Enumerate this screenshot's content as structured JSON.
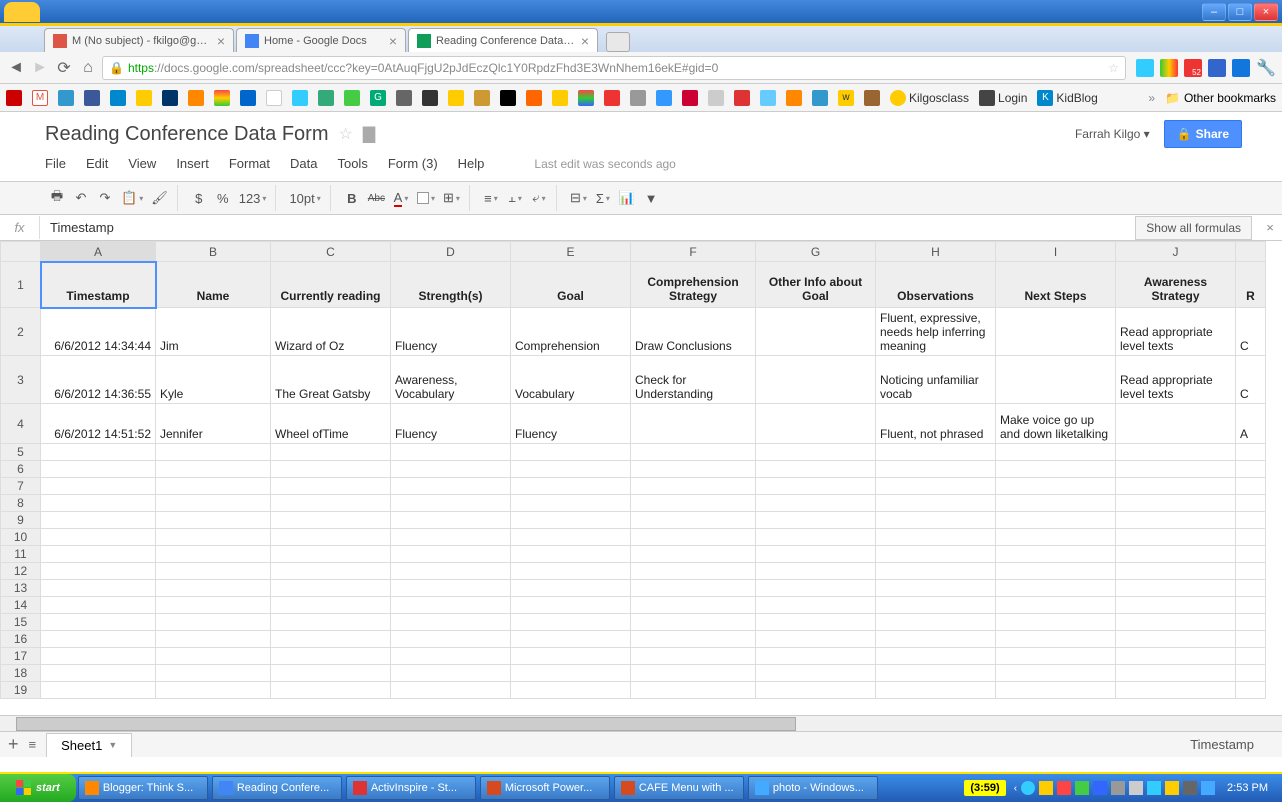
{
  "window": {
    "min": "–",
    "max": "□",
    "close": "×"
  },
  "browser_tabs": [
    {
      "favicon": "#d54",
      "label": "M (No subject) - fkilgo@gmail.co",
      "active": false
    },
    {
      "favicon": "#4285f4",
      "label": "Home - Google Docs",
      "active": false
    },
    {
      "favicon": "#0f9d58",
      "label": "Reading Conference Data For",
      "active": true
    }
  ],
  "url": {
    "scheme": "https",
    "rest": "://docs.google.com/spreadsheet/ccc?key=0AtAuqFjgU2pJdEczQlc1Y0RpdzFhd3E3WnNhem16ekE#gid=0"
  },
  "bookmarks": {
    "items": [
      "Kilgosclass",
      "Login",
      "KidBlog"
    ],
    "other": "Other bookmarks"
  },
  "docs": {
    "title": "Reading Conference Data Form",
    "user": "Farrah Kilgo",
    "share": "Share",
    "menu": [
      "File",
      "Edit",
      "View",
      "Insert",
      "Format",
      "Data",
      "Tools",
      "Form (3)",
      "Help"
    ],
    "last_edit": "Last edit was seconds ago",
    "toolbar": {
      "currency": "$",
      "percent": "%",
      "numfmt": "123",
      "font_size": "10pt",
      "bold": "B",
      "strike": "Abc"
    }
  },
  "fx": {
    "label": "fx",
    "value": "Timestamp",
    "show_all": "Show all formulas"
  },
  "sheet": {
    "columns": [
      "A",
      "B",
      "C",
      "D",
      "E",
      "F",
      "G",
      "H",
      "I",
      "J"
    ],
    "headers": [
      "Timestamp",
      "Name",
      "Currently reading",
      "Strength(s)",
      "Goal",
      "Comprehension Strategy",
      "Other Info about Goal",
      "Observations",
      "Next Steps",
      "Awareness Strategy"
    ],
    "partial_col": "R",
    "rows": [
      [
        "6/6/2012 14:34:44",
        "Jim",
        "Wizard of Oz",
        "Fluency",
        "Comprehension",
        "Draw Conclusions",
        "",
        "Fluent, expressive, needs help inferring meaning",
        "",
        "Read appropriate level texts"
      ],
      [
        "6/6/2012 14:36:55",
        "Kyle",
        "The Great Gatsby",
        "Awareness, Vocabulary",
        "Vocabulary",
        "Check for Understanding",
        "",
        "Noticing unfamiliar vocab",
        "",
        "Read appropriate level texts"
      ],
      [
        "6/6/2012 14:51:52",
        "Jennifer",
        "Wheel ofTime",
        "Fluency",
        "Fluency",
        "",
        "",
        "Fluent, not phrased",
        "Make voice go up and down liketalking",
        ""
      ]
    ],
    "partial_cells": [
      "C",
      "C",
      "A"
    ],
    "tab_name": "Sheet1",
    "status": "Timestamp"
  },
  "taskbar": {
    "start": "start",
    "items": [
      {
        "color": "#f80",
        "label": "Blogger: Think S..."
      },
      {
        "color": "#4285f4",
        "label": "Reading Confere..."
      },
      {
        "color": "#d33",
        "label": "ActivInspire - St..."
      },
      {
        "color": "#d54b1f",
        "label": "Microsoft Power..."
      },
      {
        "color": "#d54b1f",
        "label": "CAFE Menu with ..."
      },
      {
        "color": "#4af",
        "label": "photo - Windows..."
      }
    ],
    "timer": "(3:59)",
    "clock": "2:53 PM"
  }
}
